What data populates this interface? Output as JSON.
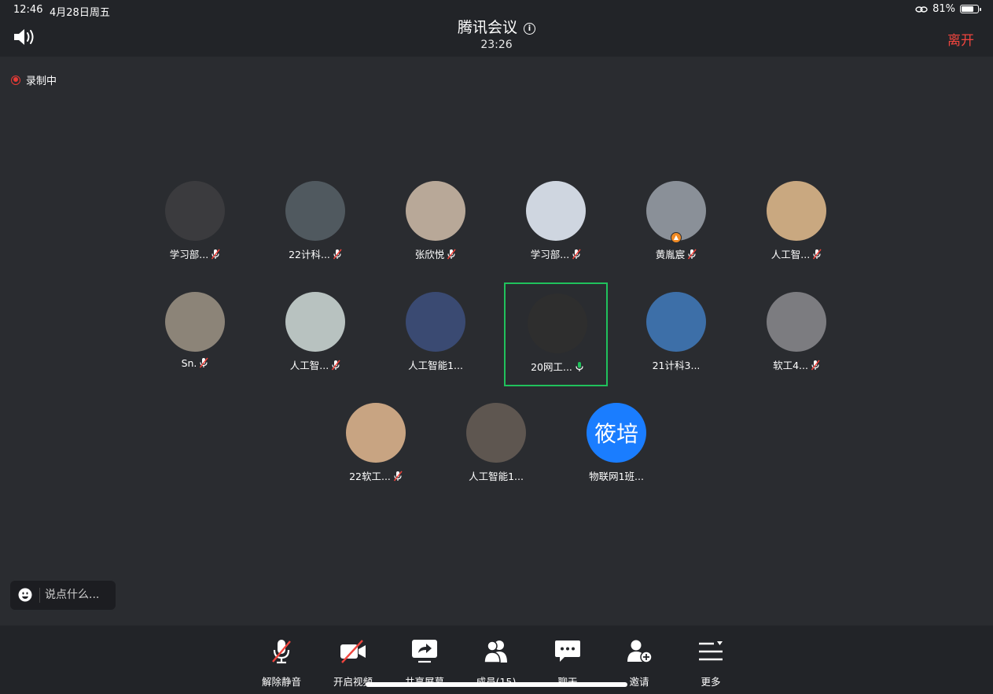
{
  "status_bar": {
    "time": "12:46",
    "date": "4月28日周五",
    "battery": "81%",
    "battery_level": 0.81
  },
  "header": {
    "title": "腾讯会议",
    "timer": "23:26",
    "leave_label": "离开"
  },
  "recording_label": "录制中",
  "participants": [
    {
      "name": "学习部...",
      "mic": "muted",
      "avatar_color": "#3b3b3e"
    },
    {
      "name": "22计科...",
      "mic": "muted",
      "avatar_color": "#50595f"
    },
    {
      "name": "张欣悦",
      "mic": "muted",
      "avatar_color": "#b8a898"
    },
    {
      "name": "学习部...",
      "mic": "muted",
      "avatar_color": "#cfd6e0"
    },
    {
      "name": "黄胤宸",
      "mic": "muted",
      "avatar_color": "#8a9098"
    },
    {
      "name": "人工智...",
      "mic": "muted",
      "avatar_color": "#c9a880"
    },
    {
      "name": "Sn.",
      "mic": "muted",
      "avatar_color": "#8c8478"
    },
    {
      "name": "人工智...",
      "mic": "muted",
      "avatar_color": "#b8c2c0"
    },
    {
      "name": "人工智能1...",
      "mic": "none",
      "avatar_color": "#3a4a72"
    },
    {
      "name": "20网工...",
      "mic": "active",
      "avatar_color": "#2e2e2e"
    },
    {
      "name": "21计科3...",
      "mic": "none",
      "avatar_color": "#3d6fa8"
    },
    {
      "name": "软工4...",
      "mic": "muted",
      "avatar_color": "#7c7c80"
    },
    {
      "name": "22软工...",
      "mic": "muted",
      "avatar_color": "#c8a482"
    },
    {
      "name": "人工智能1...",
      "mic": "none",
      "avatar_color": "#5e5650"
    },
    {
      "name": "物联网1班...",
      "mic": "none",
      "avatar_color": "#1a7dff",
      "avatar_text": "筱培"
    }
  ],
  "chat": {
    "placeholder": "说点什么..."
  },
  "toolbar": {
    "unmute": "解除静音",
    "video": "开启视频",
    "share": "共享屏幕",
    "members": "成员(15)",
    "chat": "聊天",
    "invite": "邀请",
    "more": "更多"
  },
  "colors": {
    "active_speaker": "#20c15c",
    "leave": "#f0453e",
    "recording": "#e83b36",
    "muted_slash": "#f0453e"
  }
}
